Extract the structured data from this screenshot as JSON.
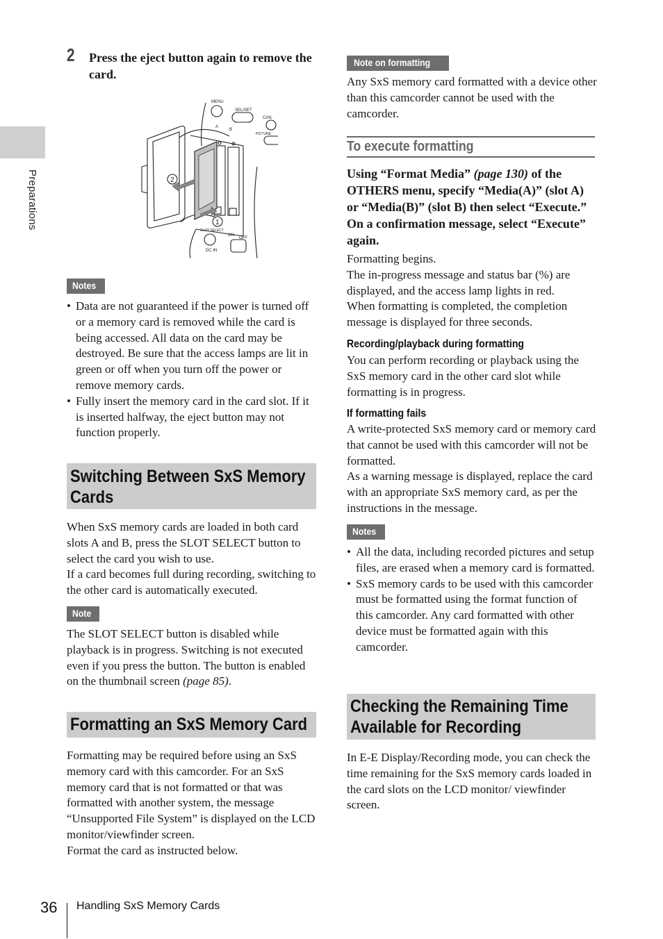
{
  "side_tab": {
    "label": "Preparations"
  },
  "step": {
    "number": "2",
    "text": "Press the eject button again to remove the card."
  },
  "figure": {
    "labels": {
      "menu": "MENU",
      "sel_set": "SEL/SET",
      "can": "CAN",
      "picture": "PICTURE",
      "slot_a": "A",
      "slot_b": "B",
      "callout_1": "1",
      "callout_2": "2",
      "slot_select": "SLOT SELECT",
      "on": "ON",
      "off": "OFF",
      "dc_in": "DC IN"
    }
  },
  "notes_left": {
    "label": "Notes",
    "items": [
      "Data are not guaranteed if the power is turned off or a memory card is removed while the card is being accessed. All data on the card may be destroyed. Be sure that the access lamps are lit in green or off when you turn off the power or remove memory cards.",
      "Fully insert the memory card in the card slot. If it is inserted halfway, the eject button may not function properly."
    ]
  },
  "switching": {
    "heading_line1": "Switching Between SxS Memory",
    "heading_line2": "Cards",
    "body_1": "When SxS memory cards are loaded in both card slots A and B, press the SLOT SELECT button to select the card you wish to use.",
    "body_2": "If a card becomes full during recording, switching to the other card is automatically executed.",
    "note_label": "Note",
    "note_text": "The SLOT SELECT button is disabled while playback is in progress. Switching is not executed even if you press the button. The button is enabled on the thumbnail screen ",
    "note_ref": "(page 85)",
    "note_end": "."
  },
  "formatting": {
    "heading": "Formatting an SxS Memory Card",
    "body_1": "Formatting may be required before using an SxS memory card with this camcorder. For an SxS memory card that is not formatted or that was formatted with another system, the message “Unsupported File System” is displayed on the LCD monitor/viewfinder screen.",
    "body_2": "Format the card as instructed below."
  },
  "note_on_formatting": {
    "label": "Note on formatting",
    "text": "Any SxS memory card formatted with a device other than this camcorder cannot be used with the camcorder."
  },
  "execute_formatting": {
    "title": "To execute formatting",
    "instr_a": "Using “Format Media” ",
    "instr_ref": "(page 130)",
    "instr_b": " of the OTHERS menu, specify “Media(A)” (slot A) or “Media(B)” (slot B) then select “Execute.” On a confirmation message, select “Execute” again.",
    "result_1": "Formatting begins.",
    "result_2": "The in-progress message and status bar (%) are displayed, and the access lamp lights in red.",
    "result_3": "When formatting is completed, the completion message is displayed for three seconds."
  },
  "rec_playback": {
    "heading": "Recording/playback during formatting",
    "text": "You can perform recording or playback using the SxS memory card in the other card slot while formatting is in progress."
  },
  "format_fails": {
    "heading": "If formatting fails",
    "text_1": "A write-protected SxS memory card or memory card that cannot be used with this camcorder will not be formatted.",
    "text_2": "As a warning message is displayed, replace the card with an appropriate SxS memory card, as per the instructions in the message."
  },
  "notes_right": {
    "label": "Notes",
    "items": [
      "All the data, including recorded pictures and setup files, are erased when a memory card is formatted.",
      "SxS memory cards to be used with this camcorder must be formatted using the format function of this camcorder. Any card formatted with other device must be formatted again with this camcorder."
    ]
  },
  "remaining_time": {
    "heading_line1": "Checking the Remaining Time",
    "heading_line2": "Available for Recording",
    "body": "In E-E Display/Recording mode, you can check the time remaining for the SxS memory cards loaded in the card slots on the LCD monitor/ viewfinder screen."
  },
  "footer": {
    "page_number": "36",
    "section_title": "Handling SxS Memory Cards"
  }
}
